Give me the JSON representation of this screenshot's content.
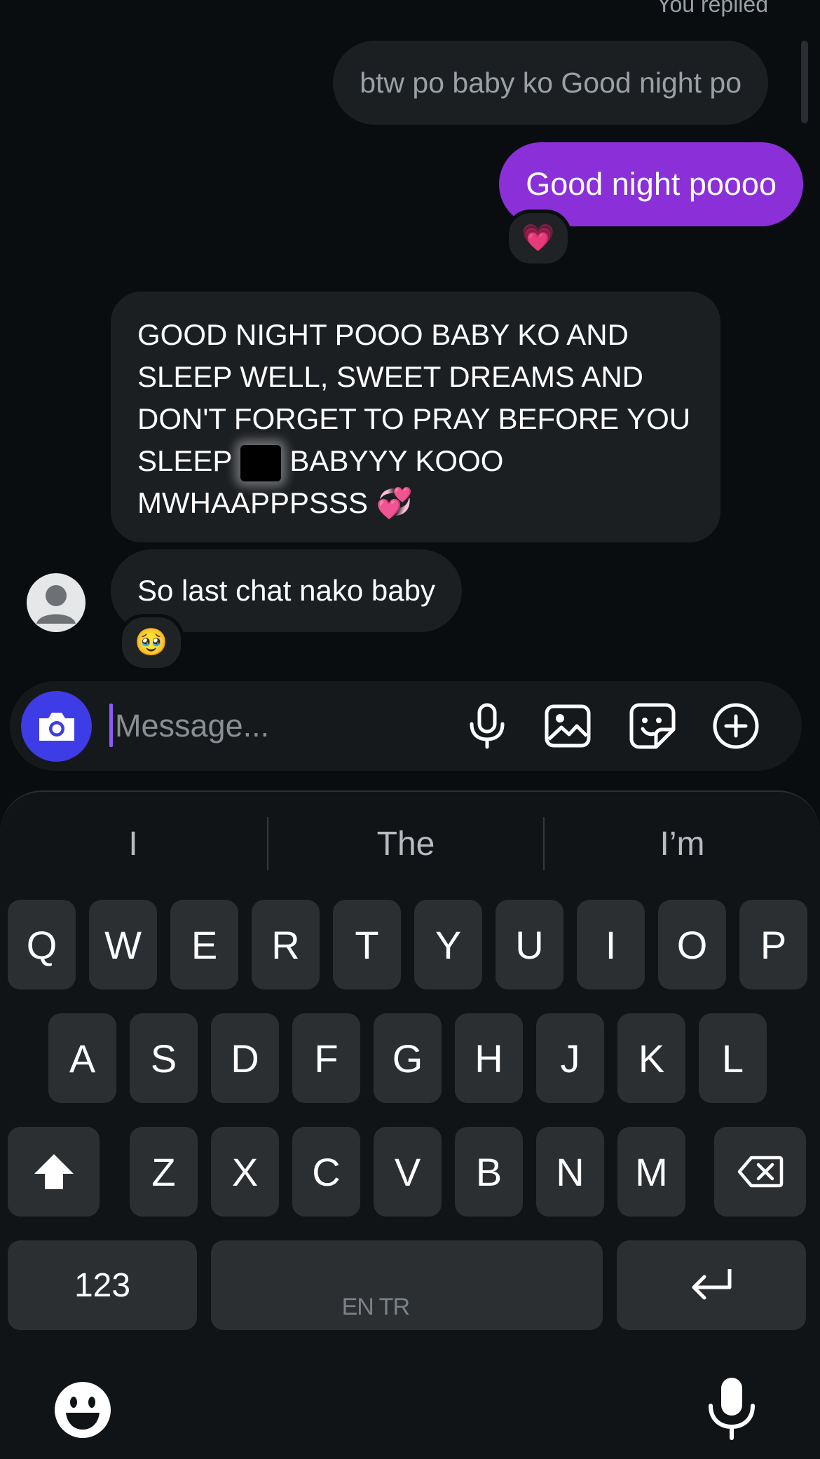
{
  "chat": {
    "replied_label": "You replied",
    "reply_quote": "btw po baby ko Good night po",
    "sent_message": "Good night poooo",
    "sent_reaction": "💗",
    "received_long_text": "GOOD NIGHT POOO BABY KO AND SLEEP WELL, SWEET DREAMS AND DON'T FORGET TO PRAY BEFORE YOU SLEEP",
    "received_long_tail": "BABYYY KOOO MWHAAPPPSSS 💞",
    "received_short": "So last chat nako baby",
    "received_reaction": "🥹"
  },
  "composer": {
    "placeholder": "Message...",
    "icons": [
      "camera-icon",
      "microphone-icon",
      "gallery-icon",
      "sticker-icon",
      "plus-circle-icon"
    ]
  },
  "keyboard": {
    "suggestions": [
      "I",
      "The",
      "I’m"
    ],
    "row1": [
      "Q",
      "W",
      "E",
      "R",
      "T",
      "Y",
      "U",
      "I",
      "O",
      "P"
    ],
    "row2": [
      "A",
      "S",
      "D",
      "F",
      "G",
      "H",
      "J",
      "K",
      "L"
    ],
    "row3": [
      "Z",
      "X",
      "C",
      "V",
      "B",
      "N",
      "M"
    ],
    "numbers_label": "123",
    "language_label": "EN TR",
    "icons": [
      "shift-icon",
      "backspace-icon",
      "enter-icon",
      "emoji-icon",
      "voice-input-icon"
    ]
  },
  "colors": {
    "sent_bubble": "#8b2fd9",
    "camera_button": "#3d3ce6",
    "background": "#0a0d0f"
  }
}
